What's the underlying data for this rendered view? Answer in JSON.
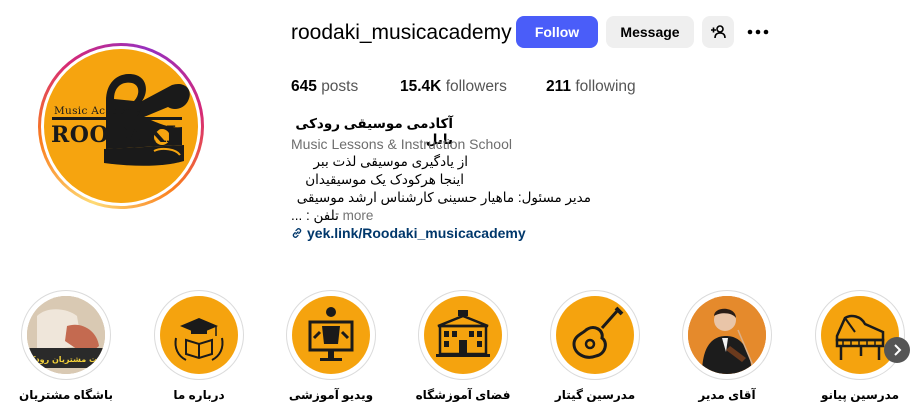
{
  "profile": {
    "username": "roodaki_musicacademy",
    "avatar_text_top": "Music Academy",
    "avatar_text_main": "ROODAKI",
    "follow_label": "Follow",
    "message_label": "Message"
  },
  "stats": {
    "posts_count": "645",
    "posts_label": "posts",
    "followers_count": "15.4K",
    "followers_label": "followers",
    "following_count": "211",
    "following_label": "following"
  },
  "bio": {
    "name": "آکادمی موسیقی رودکی بابل",
    "category": "Music Lessons & Instruction School",
    "line1": "از یادگیری موسیقی لذت ببر",
    "line2": "اینجا هرکودک یک موسیقیدان",
    "line3": "مدیر مسئول: ماهیار حسینی کارشناس ارشد موسیقی",
    "line4": "تلفن : ...",
    "more_label": "more",
    "link": "yek.link/Roodaki_musicacademy"
  },
  "highlights": [
    {
      "label": "باشگاه مشتریان",
      "icon": "customer-club-photo"
    },
    {
      "label": "درباره ما",
      "icon": "graduation-book-icon"
    },
    {
      "label": "ویدیو آموزشی",
      "icon": "video-lesson-icon"
    },
    {
      "label": "فضای آموزشگاه",
      "icon": "school-building-icon"
    },
    {
      "label": "مدرسین گیتار",
      "icon": "guitar-icon"
    },
    {
      "label": "آقای مدیر",
      "icon": "director-photo"
    },
    {
      "label": "مدرسین پیانو",
      "icon": "piano-icon"
    }
  ],
  "highlight_badge_text": "کارت مشتریان رودکی",
  "colors": {
    "follow_button": "#4a5df9",
    "highlight_bg": "#f5a30e",
    "link": "#00376b"
  }
}
